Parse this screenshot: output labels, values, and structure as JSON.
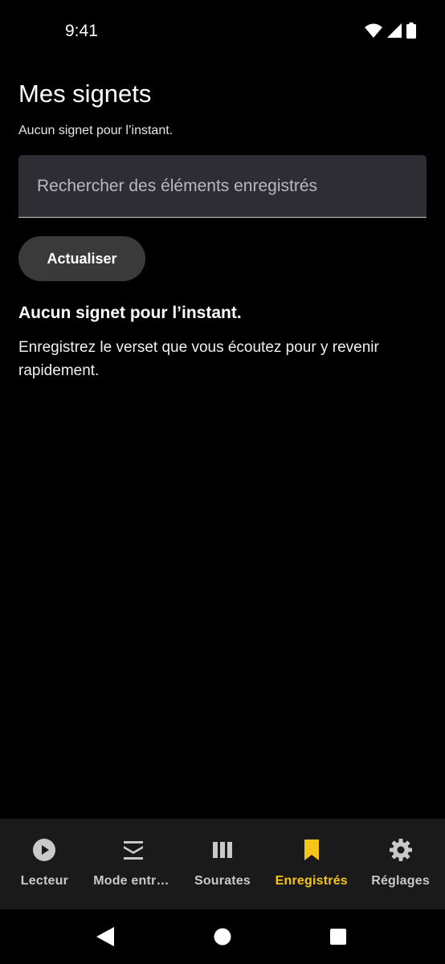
{
  "status_bar": {
    "time": "9:41"
  },
  "page": {
    "title": "Mes signets",
    "subtitle": "Aucun signet pour l’instant."
  },
  "search": {
    "placeholder": "Rechercher des éléments enregistrés",
    "value": ""
  },
  "refresh_button": {
    "label": "Actualiser"
  },
  "empty_state": {
    "title": "Aucun signet pour l’instant.",
    "description": "Enregistrez le verset que vous écoutez pour y revenir rapidement."
  },
  "bottom_nav": {
    "items": [
      {
        "label": "Lecteur",
        "icon": "play-circle-icon"
      },
      {
        "label": "Mode entraînement",
        "icon": "layers-icon"
      },
      {
        "label": "Sourates",
        "icon": "library-icon"
      },
      {
        "label": "Enregistrés",
        "icon": "bookmark-icon",
        "active": true
      },
      {
        "label": "Réglages",
        "icon": "gear-icon"
      }
    ]
  },
  "colors": {
    "background": "#000000",
    "accent": "#f5c518",
    "nav_background": "#1a1a1b",
    "search_background": "#2d2d33",
    "button_background": "#3a3a3a"
  }
}
